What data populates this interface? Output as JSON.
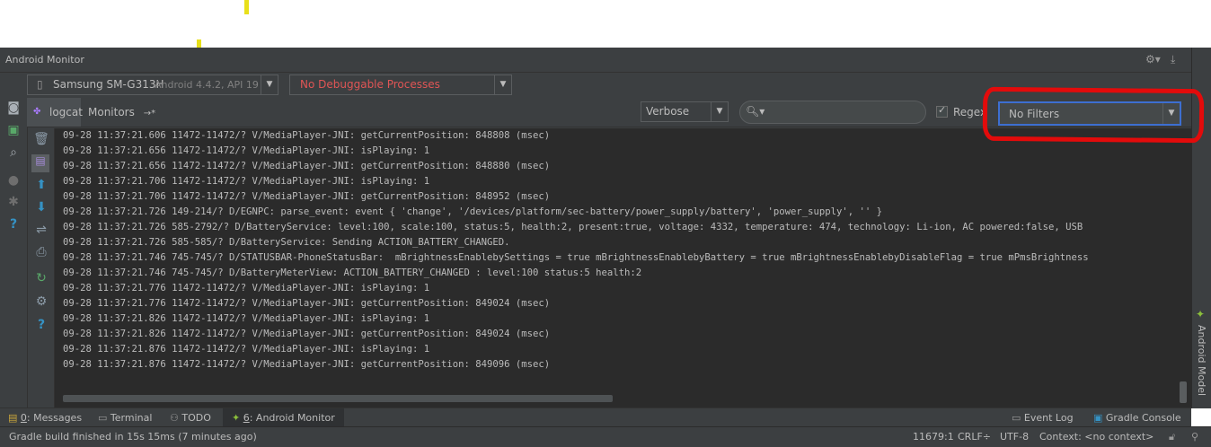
{
  "window": {
    "title": "Android Monitor"
  },
  "device": {
    "name": "Samsung SM-G313H",
    "detail": "Android 4.4.2, API 19"
  },
  "process": {
    "label": "No Debuggable Processes"
  },
  "tabs": {
    "logcat": "logcat",
    "monitors": "Monitors"
  },
  "filter": {
    "level": "Verbose",
    "search_value": "",
    "regex_label": "Regex",
    "regex_checked": true,
    "filter_select": "No Filters"
  },
  "log_lines": [
    "09-28 11:37:21.606 11472-11472/? V/MediaPlayer-JNI: getCurrentPosition: 848808 (msec)",
    "09-28 11:37:21.656 11472-11472/? V/MediaPlayer-JNI: isPlaying: 1",
    "09-28 11:37:21.656 11472-11472/? V/MediaPlayer-JNI: getCurrentPosition: 848880 (msec)",
    "09-28 11:37:21.706 11472-11472/? V/MediaPlayer-JNI: isPlaying: 1",
    "09-28 11:37:21.706 11472-11472/? V/MediaPlayer-JNI: getCurrentPosition: 848952 (msec)",
    "09-28 11:37:21.726 149-214/? D/EGNPC: parse_event: event { 'change', '/devices/platform/sec-battery/power_supply/battery', 'power_supply', '' }",
    "09-28 11:37:21.726 585-2792/? D/BatteryService: level:100, scale:100, status:5, health:2, present:true, voltage: 4332, temperature: 474, technology: Li-ion, AC powered:false, USB",
    "09-28 11:37:21.726 585-585/? D/BatteryService: Sending ACTION_BATTERY_CHANGED.",
    "09-28 11:37:21.746 745-745/? D/STATUSBAR-PhoneStatusBar:  mBrightnessEnablebySettings = true mBrightnessEnablebyBattery = true mBrightnessEnablebyDisableFlag = true mPmsBrightness",
    "09-28 11:37:21.746 745-745/? D/BatteryMeterView: ACTION_BATTERY_CHANGED : level:100 status:5 health:2",
    "09-28 11:37:21.776 11472-11472/? V/MediaPlayer-JNI: isPlaying: 1",
    "09-28 11:37:21.776 11472-11472/? V/MediaPlayer-JNI: getCurrentPosition: 849024 (msec)",
    "09-28 11:37:21.826 11472-11472/? V/MediaPlayer-JNI: isPlaying: 1",
    "09-28 11:37:21.826 11472-11472/? V/MediaPlayer-JNI: getCurrentPosition: 849024 (msec)",
    "09-28 11:37:21.876 11472-11472/? V/MediaPlayer-JNI: isPlaying: 1",
    "09-28 11:37:21.876 11472-11472/? V/MediaPlayer-JNI: getCurrentPosition: 849096 (msec)"
  ],
  "bottom_tabs": {
    "messages_key": "0",
    "messages": ": Messages",
    "terminal": "Terminal",
    "todo": "TODO",
    "monitor_key": "6",
    "monitor": ": Android Monitor",
    "event_log": "Event Log",
    "gradle_console": "Gradle Console"
  },
  "status": {
    "message": "Gradle build finished in 15s 15ms (7 minutes ago)",
    "position": "11679:1",
    "line_sep": "CRLF÷",
    "encoding": "UTF-8",
    "context": "Context: <no context>"
  },
  "side_panel": {
    "label": "Android Model"
  },
  "colors": {
    "annotation": "#e30b0b",
    "process_text": "#e05555",
    "filter_border": "#3d6fd1"
  },
  "icons": [
    "camera-icon",
    "play-icon",
    "screen-record-icon",
    "gear-icon",
    "help-icon",
    "trash-icon",
    "scroll-icon",
    "up-arrow-icon",
    "down-arrow-icon",
    "wrap-icon",
    "print-icon",
    "restart-icon",
    "settings-icon",
    "android-icon",
    "search-icon",
    "phone-icon"
  ]
}
